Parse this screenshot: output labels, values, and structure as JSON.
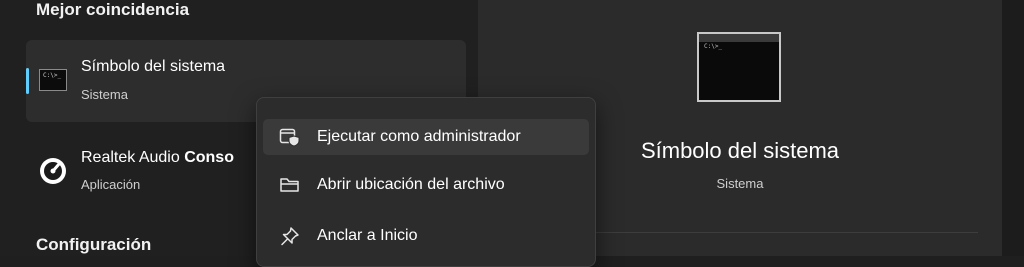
{
  "results": {
    "best_match_heading": "Mejor coincidencia",
    "best_match": {
      "title": "Símbolo del sistema",
      "subtitle": "Sistema",
      "icon": "command-prompt-icon",
      "prompt_glyph": "C:\\>_"
    },
    "apps": [
      {
        "title_prefix": "Realtek Audio ",
        "title_bold": "Conso",
        "subtitle": "Aplicación",
        "icon": "realtek-audio-console-icon"
      }
    ],
    "settings_heading": "Configuración"
  },
  "preview": {
    "title": "Símbolo del sistema",
    "subtitle": "Sistema",
    "icon": "command-prompt-icon",
    "prompt_glyph": "C:\\>_"
  },
  "context_menu": {
    "items": [
      {
        "label": "Ejecutar como administrador",
        "icon": "run-as-admin-shield-icon",
        "hovered": true
      },
      {
        "label": "Abrir ubicación del archivo",
        "icon": "folder-icon",
        "hovered": false
      },
      {
        "label": "Anclar a Inicio",
        "icon": "pin-icon",
        "hovered": false
      }
    ]
  },
  "colors": {
    "accent": "#60cdff",
    "background": "#202020",
    "panel": "#2b2b2b",
    "menu": "#2c2c2c"
  }
}
